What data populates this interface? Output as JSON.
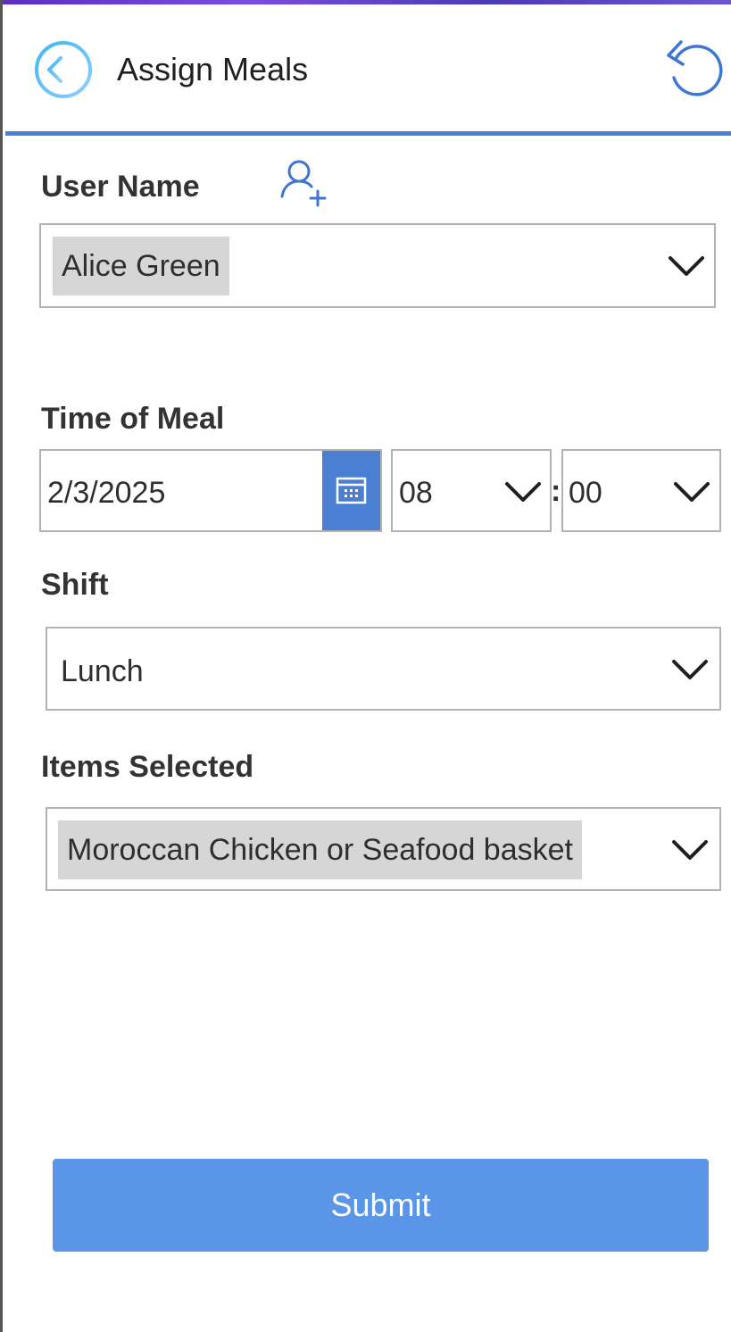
{
  "header": {
    "title": "Assign Meals",
    "back_icon": "arrow-left-circle-icon",
    "reset_icon": "reset-icon"
  },
  "user": {
    "label": "User Name",
    "add_icon": "add-user-icon",
    "selected": "Alice Green"
  },
  "time_of_meal": {
    "label": "Time of Meal",
    "date": "2/3/2025",
    "calendar_icon": "calendar-icon",
    "hour": "08",
    "separator": ":",
    "minute": "00"
  },
  "shift": {
    "label": "Shift",
    "selected": "Lunch"
  },
  "items": {
    "label": "Items Selected",
    "selected": "Moroccan Chicken or Seafood basket"
  },
  "submit": {
    "label": "Submit"
  },
  "colors": {
    "accent": "#4a7fd4",
    "submit_bg": "#5b95e8",
    "chip_bg": "#d6d6d6",
    "back_icon_gradient": [
      "#3fb6f0",
      "#8ad0ff"
    ]
  }
}
